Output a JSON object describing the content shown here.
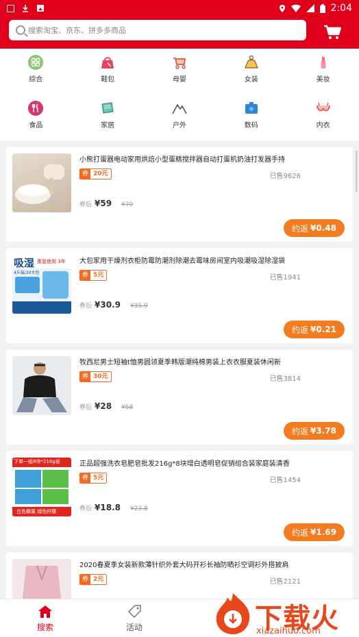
{
  "status": {
    "time": "2:04"
  },
  "search": {
    "placeholder": "搜索淘宝、京东、拼多多商品"
  },
  "categories": [
    {
      "label": "综合",
      "icon": "grid-icon",
      "color": "#7bbf6a"
    },
    {
      "label": "鞋包",
      "icon": "bag-icon",
      "color": "#e2465a"
    },
    {
      "label": "母婴",
      "icon": "stroller-icon",
      "color": "#d8574c"
    },
    {
      "label": "女装",
      "icon": "dress-icon",
      "color": "#e0b040"
    },
    {
      "label": "美妆",
      "icon": "lipstick-icon",
      "color": "#f06a7e"
    },
    {
      "label": "食品",
      "icon": "fork-knife-icon",
      "color": "#d8356a"
    },
    {
      "label": "家居",
      "icon": "home-goods-icon",
      "color": "#3aa8a0"
    },
    {
      "label": "户外",
      "icon": "mountain-icon",
      "color": "#c34a3c"
    },
    {
      "label": "数码",
      "icon": "digital-icon",
      "color": "#2e86d8"
    },
    {
      "label": "内衣",
      "icon": "bra-icon",
      "color": "#d8574c"
    }
  ],
  "products": [
    {
      "title": "小熊打蛋器电动家用烘焙小型蛋糕搅拌器自动打蛋机奶油打发器手持",
      "coupon_label": "券",
      "coupon_value": "20元",
      "sold": "已售9626",
      "after_label": "券后",
      "price": "¥59",
      "orig": "¥79",
      "rebate_label": "约返",
      "rebate_value": "¥0.48"
    },
    {
      "title": "大包家用干燥剂衣柜防霉防潮剂除潮去霉味房间室内吸潮吸湿除湿袋",
      "coupon_label": "券",
      "coupon_value": "5元",
      "sold": "已售1941",
      "after_label": "券后",
      "price": "¥30.9",
      "orig": "¥35.9",
      "rebate_label": "约返",
      "rebate_value": "¥0.21",
      "thumb_text": "吸湿",
      "thumb_sub": "重复使用 3年",
      "thumb_note": "4斤装/20大包"
    },
    {
      "title": "牧西尼男士短袖t恤男圆领夏季韩版潮纯棉男装上衣衣服夏装休闲新",
      "coupon_label": "券",
      "coupon_value": "30元",
      "sold": "已售3814",
      "after_label": "券后",
      "price": "¥28",
      "orig": "¥58",
      "rebate_label": "约返",
      "rebate_value": "¥3.78"
    },
    {
      "title": "正品超强洗衣皂肥皂批发216g*8块增白透明皂促销组合装家庭装清香",
      "coupon_label": "券",
      "coupon_value": "5元",
      "sold": "已售1454",
      "after_label": "券后",
      "price": "¥18.8",
      "orig": "¥23.8",
      "rebate_label": "约返",
      "rebate_value": "¥1.69",
      "thumb_text": "下单一组8块*216g皂",
      "thumb_bottom": "白色椰果 绿色柠檬"
    },
    {
      "title": "2020春夏季女装新款薄针织外套大码开衫长袖防晒衫空调衫外搭披肩",
      "coupon_label": "券",
      "coupon_value": "2元",
      "sold": "已售2121"
    }
  ],
  "nav": [
    {
      "label": "搜索",
      "icon": "home-icon",
      "active": true
    },
    {
      "label": "活动",
      "icon": "tag-icon",
      "active": false
    }
  ],
  "watermark": {
    "text": "下载火",
    "url": "xiazaihuo.com"
  },
  "colors": {
    "brand": "#e0001b",
    "accent": "#f47c20"
  }
}
